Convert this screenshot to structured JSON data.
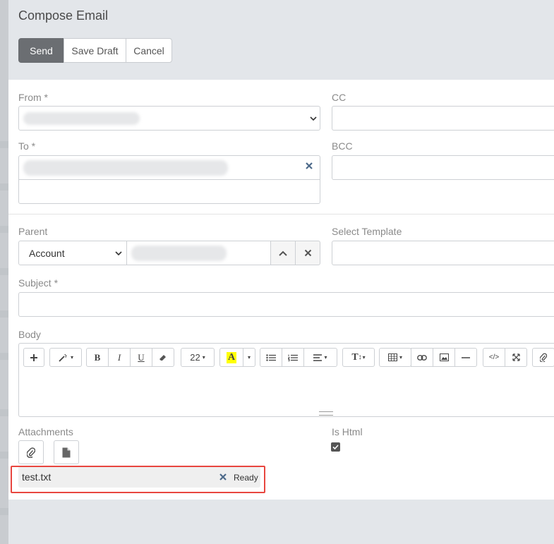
{
  "modal": {
    "title": "Compose Email",
    "buttons": {
      "send": "Send",
      "save_draft": "Save Draft",
      "cancel": "Cancel"
    }
  },
  "form": {
    "from_label": "From *",
    "cc_label": "CC",
    "to_label": "To *",
    "bcc_label": "BCC",
    "parent_label": "Parent",
    "parent_type": "Account",
    "select_template_label": "Select Template",
    "subject_label": "Subject *",
    "body_label": "Body",
    "font_size": "22",
    "attachments_label": "Attachments",
    "is_html_label": "Is Html",
    "is_html_checked": true
  },
  "attachment": {
    "filename": "test.txt",
    "status": "Ready"
  },
  "icons": {
    "clear_recipient": "close-icon",
    "parent_select": "chevron-up-icon",
    "parent_clear": "close-icon",
    "attach_file": "paperclip-icon",
    "attach_document": "document-icon"
  },
  "colors": {
    "primary_button": "#6b6e72",
    "highlight": "#e8463f",
    "icon_blue": "#4d6a8a"
  }
}
